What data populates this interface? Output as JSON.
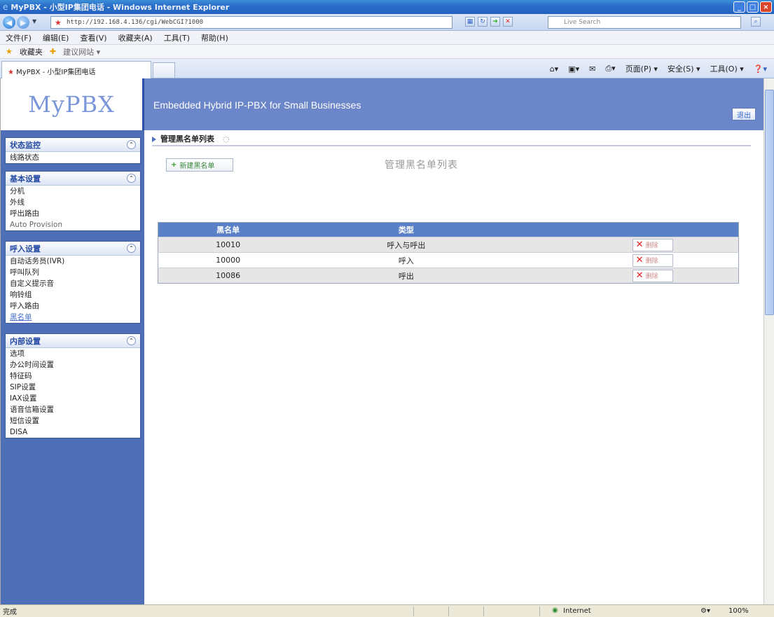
{
  "window": {
    "title": "MyPBX - 小型IP集团电话 - Windows Internet Explorer"
  },
  "address": {
    "url": "http://192.168.4.136/cgi/WebCGI?1000",
    "search_placeholder": "Live Search"
  },
  "menu": [
    "文件(F)",
    "编辑(E)",
    "查看(V)",
    "收藏夹(A)",
    "工具(T)",
    "帮助(H)"
  ],
  "favbar": {
    "favorites": "收藏夹",
    "suggested": "建议网站 ▾"
  },
  "tabs": {
    "active_title": "MyPBX - 小型IP集团电话"
  },
  "commands": {
    "page": "页面(P) ▾",
    "safety": "安全(S) ▾",
    "tools": "工具(O) ▾"
  },
  "brand": {
    "logo": "MyPBX",
    "slogan": "Embedded Hybrid IP-PBX for Small Businesses",
    "logout": "退出"
  },
  "sidebar": {
    "groups": [
      {
        "title": "状态监控",
        "items": [
          "线路状态"
        ]
      },
      {
        "title": "基本设置",
        "items": [
          "分机",
          "外线",
          "呼出路由",
          "Auto Provision"
        ]
      },
      {
        "title": "呼入设置",
        "items": [
          "自动话务员(IVR)",
          "呼叫队列",
          "自定义提示音",
          "响铃组",
          "呼入路由",
          "黑名单"
        ]
      },
      {
        "title": "内部设置",
        "items": [
          "选项",
          "办公时间设置",
          "特征码",
          "SIP设置",
          "IAX设置",
          "语音信箱设置",
          "短信设置",
          "DISA"
        ]
      }
    ],
    "active_item": "黑名单"
  },
  "main": {
    "breadcrumb": "管理黑名单列表",
    "new_button": "新建黑名单",
    "list_title": "管理黑名单列表",
    "table": {
      "headers": [
        "黑名单",
        "类型",
        ""
      ],
      "rows": [
        {
          "number": "10010",
          "type": "呼入与呼出",
          "action": "删除"
        },
        {
          "number": "10000",
          "type": "呼入",
          "action": "删除"
        },
        {
          "number": "10086",
          "type": "呼出",
          "action": "删除"
        }
      ]
    }
  },
  "status": {
    "left": "完成",
    "zone": "Internet",
    "zoom": "100%"
  },
  "colors": {
    "header_bg": "#6b86c9",
    "sidebar_bg": "#4e6fb8",
    "table_head": "#5a80c8",
    "delete_x": "#e02020"
  }
}
